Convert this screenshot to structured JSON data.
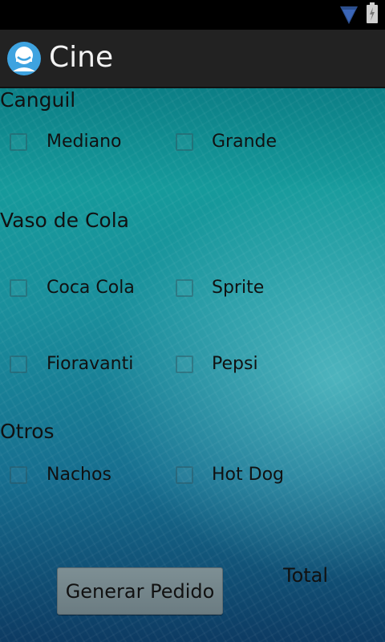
{
  "app": {
    "title": "Cine"
  },
  "sections": {
    "canguil": {
      "label": "Canguil",
      "options": [
        "Mediano",
        "Grande"
      ]
    },
    "vaso": {
      "label": "Vaso de Cola",
      "options": [
        "Coca Cola",
        "Sprite",
        "Fioravanti",
        "Pepsi"
      ]
    },
    "otros": {
      "label": "Otros",
      "options": [
        "Nachos",
        "Hot Dog"
      ]
    }
  },
  "order": {
    "button_label": "Generar Pedido",
    "total_label": "Total"
  },
  "colors": {
    "accent": "#169a9b",
    "actionbar": "#222222"
  },
  "icons": {
    "status": [
      "wifi-icon",
      "battery-icon"
    ],
    "app": "app-icon"
  }
}
